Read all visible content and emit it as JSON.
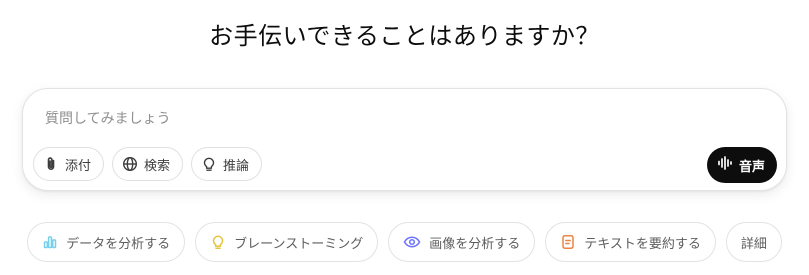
{
  "headline": "お手伝いできることはありますか？",
  "composer": {
    "placeholder": "質問してみましょう",
    "tools": [
      {
        "label": "添付",
        "icon": "paperclip-icon"
      },
      {
        "label": "検索",
        "icon": "globe-icon"
      },
      {
        "label": "推論",
        "icon": "lightbulb-icon"
      }
    ],
    "voice_label": "音声",
    "voice_icon": "waveform-icon"
  },
  "suggestions": [
    {
      "label": "データを分析する",
      "icon": "bar-chart-icon",
      "color": "#76d0eb"
    },
    {
      "label": "ブレーンストーミング",
      "icon": "lightbulb-icon",
      "color": "#e2c541"
    },
    {
      "label": "画像を分析する",
      "icon": "eye-icon",
      "color": "#6c71ff"
    },
    {
      "label": "テキストを要約する",
      "icon": "document-icon",
      "color": "#ea8444"
    },
    {
      "label": "詳細"
    }
  ]
}
